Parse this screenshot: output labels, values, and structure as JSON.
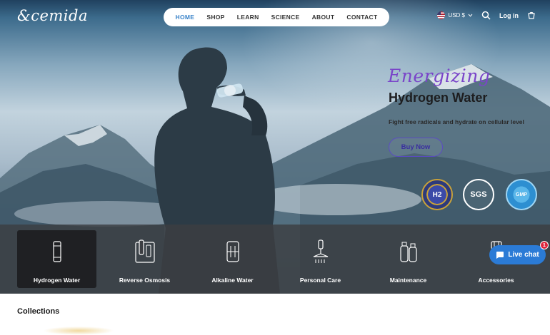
{
  "header": {
    "logo": "&cemida",
    "nav": [
      "HOME",
      "SHOP",
      "LEARN",
      "SCIENCE",
      "ABOUT",
      "CONTACT"
    ],
    "active_nav": "HOME",
    "currency": "USD $",
    "login": "Log in"
  },
  "hero": {
    "tagline": "Energizing",
    "headline": "Hydrogen Water",
    "subline": "Fight free radicals and hydrate on cellular level",
    "cta": "Buy Now",
    "badges": {
      "h2": "H2",
      "sgs": "SGS",
      "gmp": "GMP"
    }
  },
  "categories": [
    {
      "label": "Hydrogen Water",
      "icon": "bottle-icon"
    },
    {
      "label": "Reverse Osmosis",
      "icon": "fridge-filter-icon"
    },
    {
      "label": "Alkaline Water",
      "icon": "filter-cartridge-icon"
    },
    {
      "label": "Personal Care",
      "icon": "shower-icon"
    },
    {
      "label": "Maintenance",
      "icon": "bottles-icon"
    },
    {
      "label": "Accessories",
      "icon": "accessory-icon"
    }
  ],
  "chat": {
    "label": "Live chat",
    "count": "1"
  },
  "collections": {
    "title": "Collections"
  },
  "colors": {
    "accent": "#3a83c9",
    "tagline": "#7a45c9",
    "chat": "#2b7bd6"
  }
}
